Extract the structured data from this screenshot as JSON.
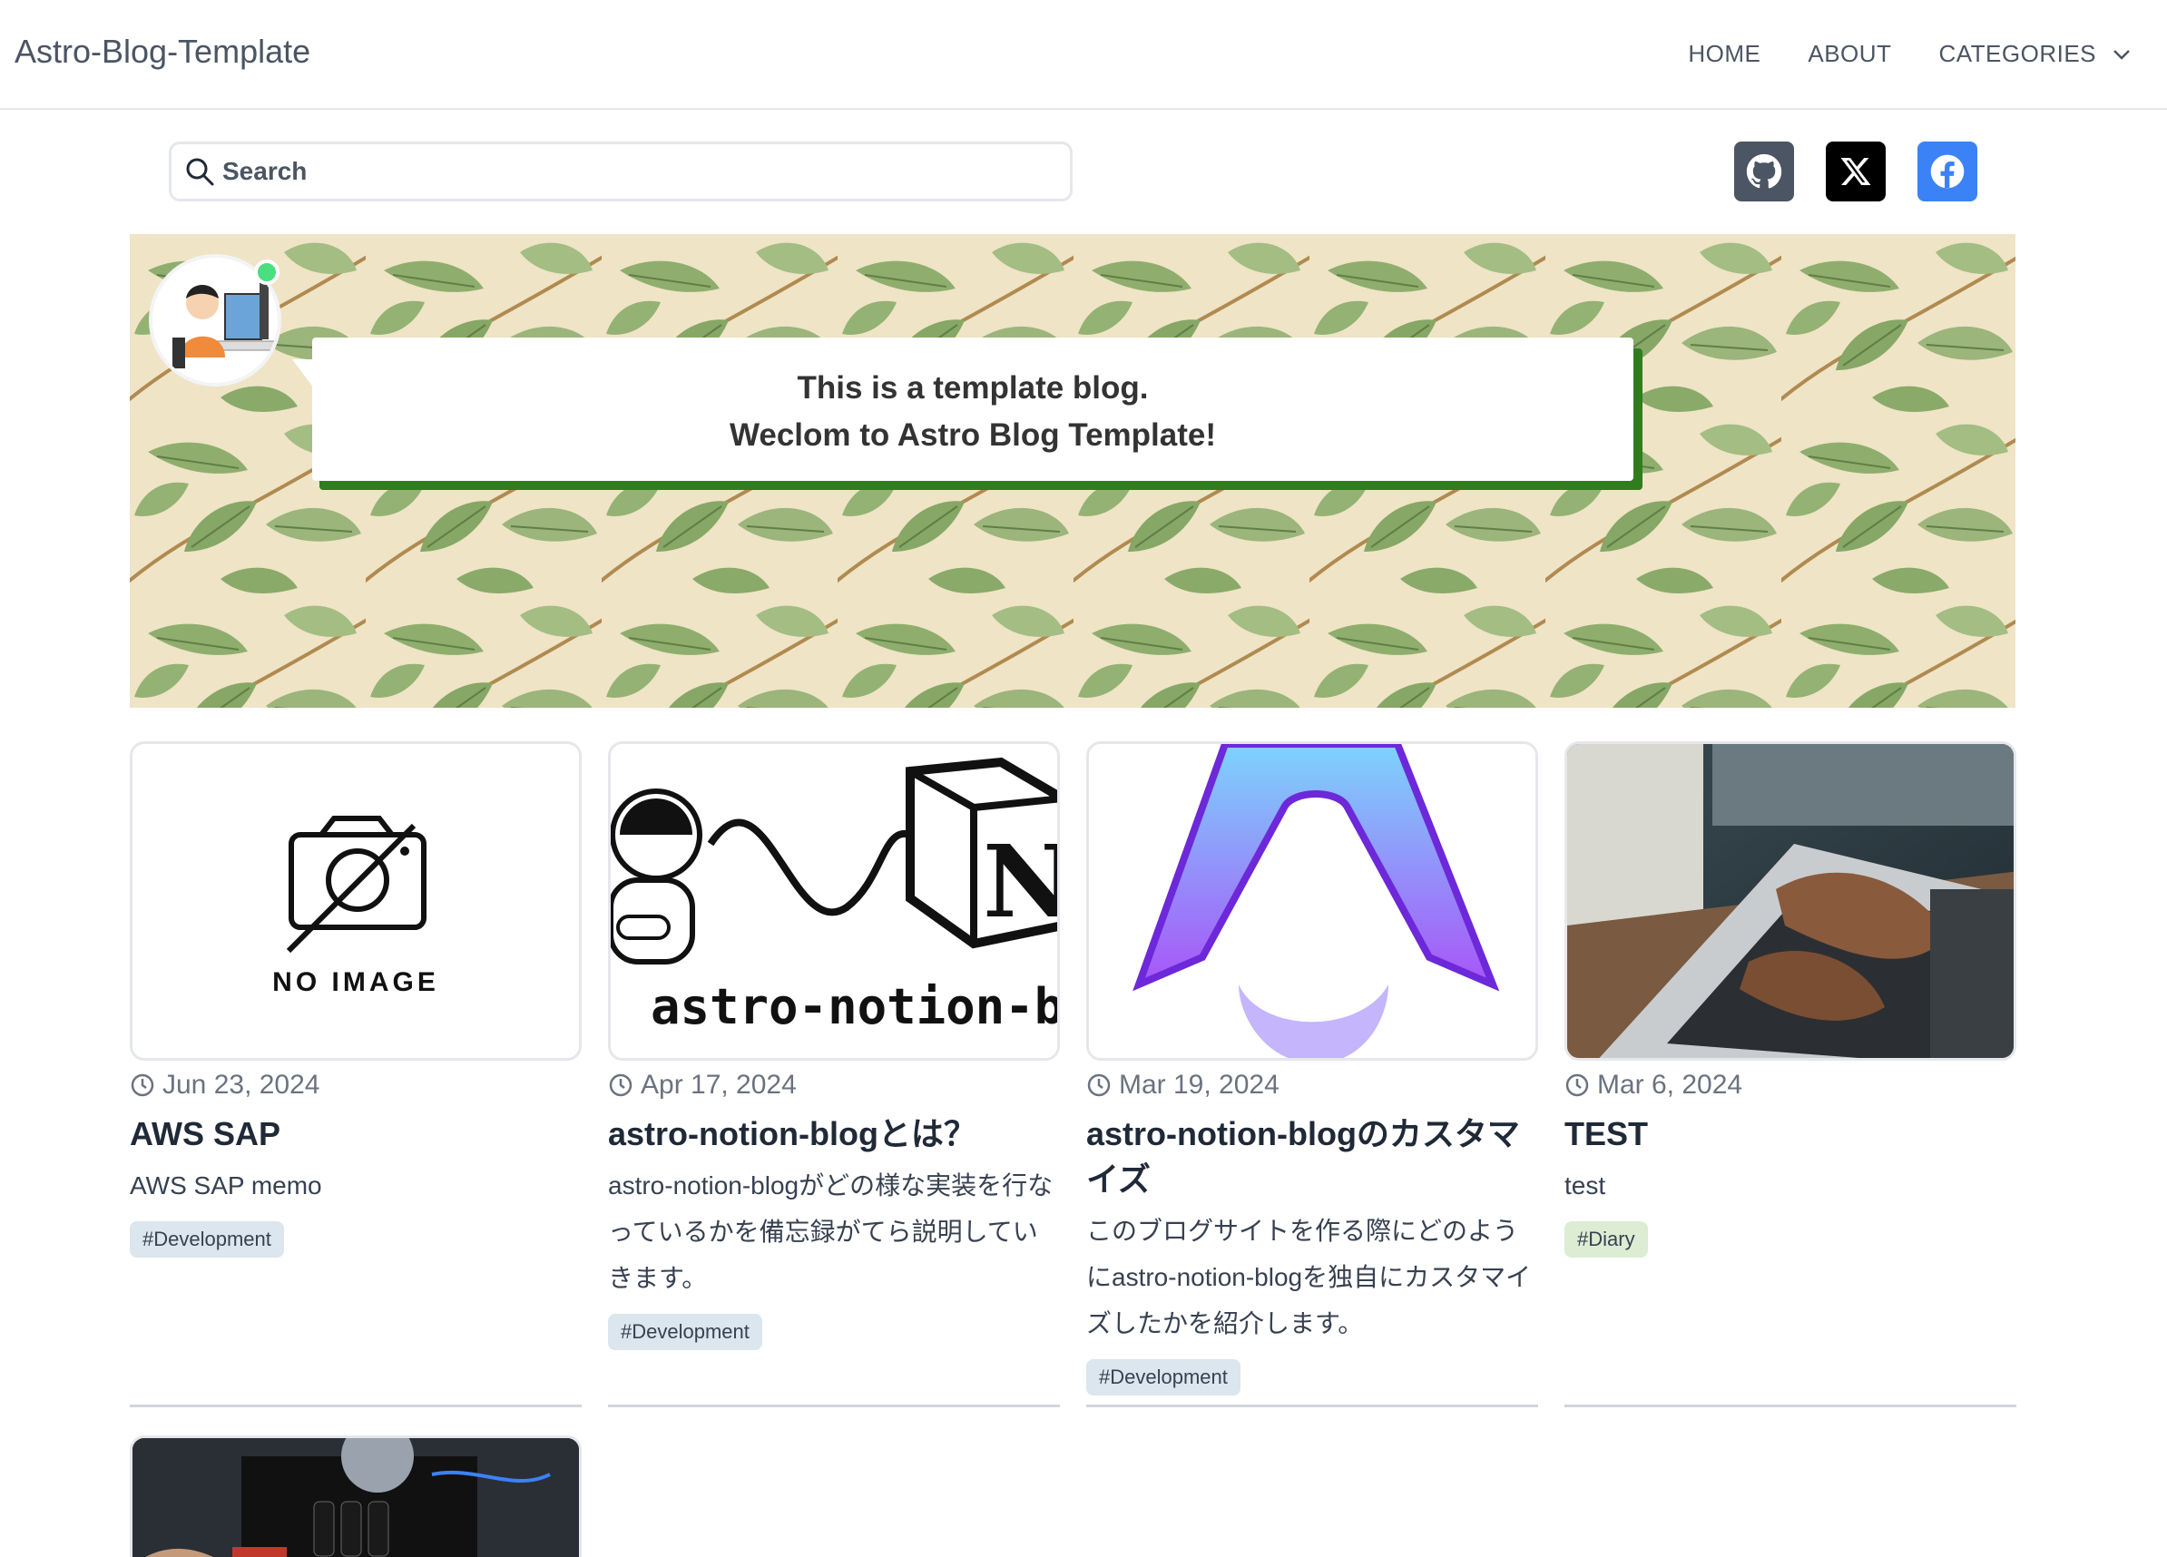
{
  "header": {
    "brand": "Astro-Blog-Template",
    "nav": {
      "home": "HOME",
      "about": "ABOUT",
      "categories": "CATEGORIES"
    }
  },
  "search": {
    "placeholder": "Search"
  },
  "social": [
    {
      "icon": "github-icon",
      "color": "#4b5563"
    },
    {
      "icon": "x-icon",
      "color": "#000000"
    },
    {
      "icon": "facebook-icon",
      "color": "#3b82f6"
    }
  ],
  "hero": {
    "line1": "This is a template blog.",
    "line2": "Weclom to Astro Blog Template!"
  },
  "thumbs": {
    "no_image": "NO IMAGE",
    "notion_caption": "astro-notion-bl"
  },
  "posts": [
    {
      "date": "Jun 23, 2024",
      "title": "AWS SAP",
      "desc": "AWS SAP memo",
      "tag": "#Development"
    },
    {
      "date": "Apr 17, 2024",
      "title": "astro-notion-blogとは？",
      "desc": "astro-notion-blogがどの様な実装を行なっているかを備忘録がてら説明していきます。",
      "tag": "#Development"
    },
    {
      "date": "Mar 19, 2024",
      "title": "astro-notion-blogのカスタマイズ",
      "desc": "このブログサイトを作る際にどのようにastro-notion-blogを独自にカスタマイズしたかを紹介します。",
      "tag": "#Development"
    },
    {
      "date": "Mar 6, 2024",
      "title": "TEST",
      "desc": "test",
      "tag": "#Diary"
    }
  ]
}
